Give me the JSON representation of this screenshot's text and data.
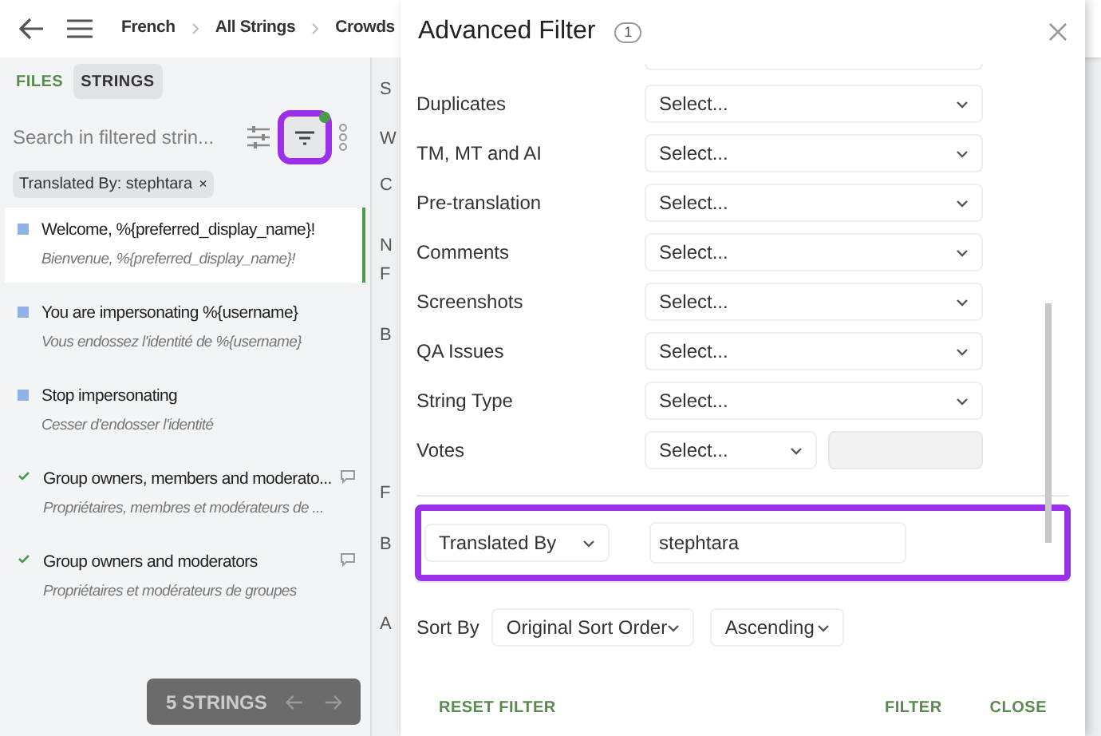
{
  "breadcrumb": [
    "French",
    "All Strings",
    "Crowds"
  ],
  "side_tabs": [
    {
      "label": "FILES",
      "selected": false
    },
    {
      "label": "STRINGS",
      "selected": true
    }
  ],
  "search": {
    "placeholder": "Search in filtered strin..."
  },
  "filter_button": {
    "active": true,
    "highlighted": true
  },
  "filter_chip": {
    "label": "Translated By: stephtara",
    "close": "×"
  },
  "strings": [
    {
      "source": "Welcome, %{preferred_display_name}!",
      "translation": "Bienvenue, %{preferred_display_name}!",
      "translated": false,
      "selected": true,
      "has_comment": false
    },
    {
      "source": "You are impersonating %{username}",
      "translation": "Vous endossez l'identité de %{username}",
      "translated": false,
      "selected": false,
      "has_comment": false
    },
    {
      "source": "Stop impersonating",
      "translation": "Cesser d'endosser l'identité",
      "translated": false,
      "selected": false,
      "has_comment": false
    },
    {
      "source": "Group owners, members and moderato...",
      "translation": "Propriétaires, membres et modérateurs de ...",
      "translated": true,
      "selected": false,
      "has_comment": true
    },
    {
      "source": "Group owners and moderators",
      "translation": "Propriétaires et modérateurs de groupes",
      "translated": true,
      "selected": false,
      "has_comment": true
    }
  ],
  "pager": {
    "label": "5 STRINGS"
  },
  "background_fragments": [
    "S",
    "W",
    "C",
    "N",
    "F",
    "B",
    "F",
    "B",
    "A"
  ],
  "dialog": {
    "title": "Advanced Filter",
    "count": "1",
    "filters": [
      {
        "label": "Duplicates",
        "value": "Select...",
        "kind": "select"
      },
      {
        "label": "TM, MT and AI",
        "value": "Select...",
        "kind": "select"
      },
      {
        "label": "Pre-translation",
        "value": "Select...",
        "kind": "select"
      },
      {
        "label": "Comments",
        "value": "Select...",
        "kind": "select"
      },
      {
        "label": "Screenshots",
        "value": "Select...",
        "kind": "select"
      },
      {
        "label": "QA Issues",
        "value": "Select...",
        "kind": "select"
      },
      {
        "label": "String Type",
        "value": "Select...",
        "kind": "select"
      },
      {
        "label": "Votes",
        "value": "Select...",
        "kind": "select-input"
      }
    ],
    "condition": {
      "field": "Translated By",
      "value": "stephtara",
      "highlighted": true
    },
    "sort": {
      "label": "Sort By",
      "field": "Original Sort Order",
      "order": "Ascending"
    },
    "buttons": {
      "reset": "RESET FILTER",
      "filter": "FILTER",
      "close": "CLOSE"
    }
  }
}
